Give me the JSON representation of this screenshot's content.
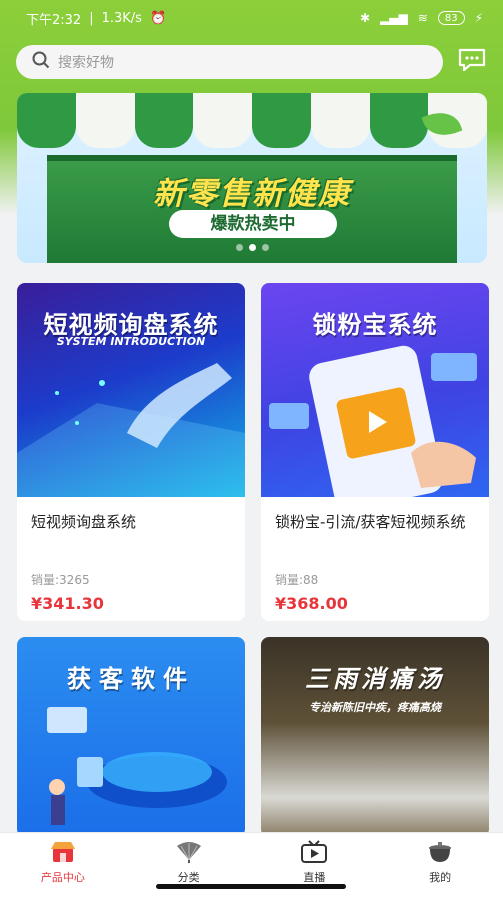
{
  "status_bar": {
    "time": "下午2:32",
    "speed": "1.3K/s",
    "battery": "83"
  },
  "search": {
    "placeholder": "搜索好物"
  },
  "banner": {
    "title": "新零售新健康",
    "subtitle": "爆款热卖中",
    "active_dot": 2,
    "dot_count": 3
  },
  "products": [
    {
      "thumb_title": "短视频询盘系统",
      "thumb_sub": "SYSTEM INTRODUCTION",
      "name": "短视频询盘系统",
      "sales": "销量:3265",
      "price": "¥341.30"
    },
    {
      "thumb_title": "锁粉宝系统",
      "thumb_sub": "",
      "name": "锁粉宝-引流/获客短视频系统",
      "sales": "销量:88",
      "price": "¥368.00"
    },
    {
      "thumb_title": "获客软件",
      "thumb_sub": ""
    },
    {
      "thumb_title": "三雨消痛汤",
      "thumb_sub": "专治新陈旧中疾，疼痛高烧"
    }
  ],
  "tabbar": {
    "items": [
      {
        "label": "产品中心",
        "icon": "store-icon",
        "active": true
      },
      {
        "label": "分类",
        "icon": "fan-icon",
        "active": false
      },
      {
        "label": "直播",
        "icon": "tv-icon",
        "active": false
      },
      {
        "label": "我的",
        "icon": "pot-icon",
        "active": false
      }
    ]
  },
  "colors": {
    "accent": "#e8353b",
    "header_green": "#8ccf3a"
  }
}
